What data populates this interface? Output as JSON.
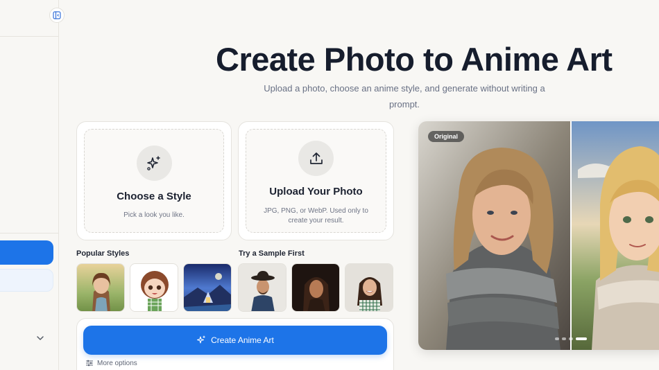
{
  "hero": {
    "title": "Create Photo to Anime Art",
    "subtitle": "Upload a photo, choose an anime style, and generate without writing a prompt."
  },
  "style_card": {
    "icon": "sparkles-icon",
    "title": "Choose a Style",
    "desc": "Pick a look you like."
  },
  "upload_card": {
    "icon": "upload-icon",
    "title": "Upload Your Photo",
    "desc": "JPG, PNG, or WebP. Used only to create your result."
  },
  "popular_styles": {
    "label": "Popular Styles",
    "items": [
      {
        "name": "style-thumb-painterly"
      },
      {
        "name": "style-thumb-chibi"
      },
      {
        "name": "style-thumb-fantasy-landscape"
      }
    ]
  },
  "samples": {
    "label": "Try a Sample First",
    "items": [
      {
        "name": "sample-thumb-man-cowboy-hat"
      },
      {
        "name": "sample-thumb-woman-dark"
      },
      {
        "name": "sample-thumb-woman-smiling"
      }
    ]
  },
  "actions": {
    "create_label": "Create Anime Art",
    "more_options_label": "More options"
  },
  "preview": {
    "badge": "Original",
    "active_slide": 4,
    "slide_count": 4
  },
  "colors": {
    "accent": "#1d74e8",
    "background": "#f8f7f4",
    "title": "#161d2d"
  }
}
